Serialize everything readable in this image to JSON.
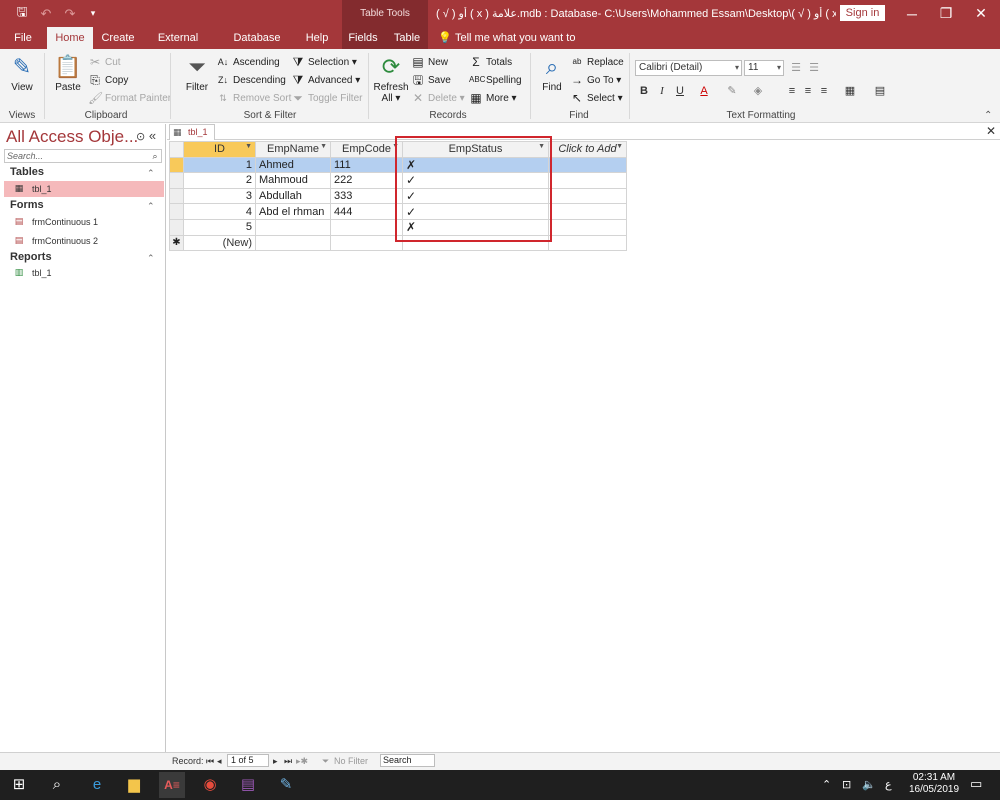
{
  "titlebar": {
    "context_group": "Table Tools",
    "title": "( √ ) أو ( x ) علامة.mdb : Database- C:\\Users\\Mohammed Essam\\Desktop\\( √ ) أو ( x ) علامة.mdb (Acc...",
    "sign_in": "Sign in",
    "minimize": "─",
    "restore": "❐",
    "close": "✕"
  },
  "tabs": {
    "file": "File",
    "home": "Home",
    "create": "Create",
    "external": "External Data",
    "dbtools": "Database Tools",
    "help": "Help",
    "fields": "Fields",
    "table": "Table",
    "tellme": "Tell me what you want to do"
  },
  "ribbon": {
    "views": {
      "label": "Views",
      "view": "View"
    },
    "clipboard": {
      "label": "Clipboard",
      "paste": "Paste",
      "cut": "Cut",
      "copy": "Copy",
      "format_painter": "Format Painter"
    },
    "sortfilter": {
      "label": "Sort & Filter",
      "filter": "Filter",
      "ascending": "Ascending",
      "descending": "Descending",
      "remove_sort": "Remove Sort",
      "selection": "Selection ▾",
      "advanced": "Advanced ▾",
      "toggle_filter": "Toggle Filter"
    },
    "records": {
      "label": "Records",
      "refresh": "Refresh",
      "refresh_all": "All ▾",
      "new": "New",
      "save": "Save",
      "delete": "Delete ▾",
      "totals": "Totals",
      "spelling": "Spelling",
      "more": "More ▾"
    },
    "find": {
      "label": "Find",
      "find": "Find",
      "replace": "Replace",
      "goto": "Go To ▾",
      "select": "Select ▾"
    },
    "textfmt": {
      "label": "Text Formatting",
      "font": "Calibri (Detail)",
      "size": "11"
    }
  },
  "nav": {
    "title": "All Access Obje...",
    "search_placeholder": "Search...",
    "sections": [
      {
        "name": "Tables",
        "items": [
          "tbl_1"
        ]
      },
      {
        "name": "Forms",
        "items": [
          "frmContinuous 1",
          "frmContinuous 2"
        ]
      },
      {
        "name": "Reports",
        "items": [
          "tbl_1"
        ]
      }
    ]
  },
  "document": {
    "tab": "tbl_1",
    "columns": [
      "ID",
      "EmpName",
      "EmpCode",
      "EmpStatus",
      "Click to Add"
    ],
    "rows": [
      {
        "id": "1",
        "name": "Ahmed",
        "code": "111",
        "status": "✗"
      },
      {
        "id": "2",
        "name": "Mahmoud",
        "code": "222",
        "status": "✓"
      },
      {
        "id": "3",
        "name": "Abdullah",
        "code": "333",
        "status": "✓"
      },
      {
        "id": "4",
        "name": "Abd el rhman",
        "code": "444",
        "status": "✓"
      },
      {
        "id": "5",
        "name": "",
        "code": "",
        "status": "✗"
      }
    ],
    "new_row": "(New)"
  },
  "statusbar": {
    "record_label": "Record:",
    "position": "1 of 5",
    "no_filter": "No Filter",
    "search": "Search"
  },
  "taskbar": {
    "time": "02:31 AM",
    "date": "16/05/2019",
    "lang": "ع"
  },
  "colors": {
    "accent": "#a4373a",
    "selected_header": "#f8c95a",
    "selected_row": "#b4cff0",
    "highlight_box": "#d0262d"
  }
}
